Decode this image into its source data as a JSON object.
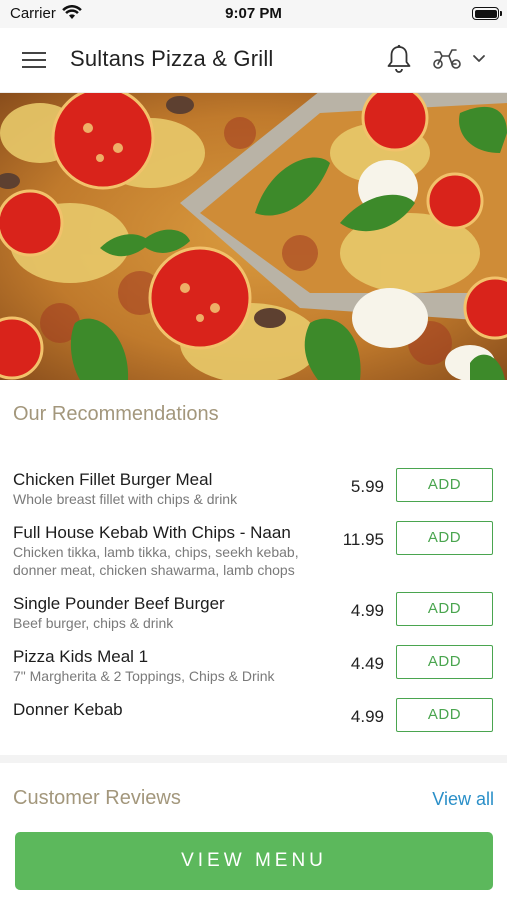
{
  "status_bar": {
    "carrier": "Carrier",
    "time": "9:07 PM"
  },
  "header": {
    "title": "Sultans Pizza & Grill"
  },
  "recommendations": {
    "title": "Our Recommendations",
    "items": [
      {
        "name": "Chicken Fillet Burger Meal",
        "desc": "Whole breast fillet with chips & drink",
        "price": "5.99",
        "add_label": "ADD"
      },
      {
        "name": "Full House Kebab With Chips - Naan",
        "desc": "Chicken tikka, lamb tikka, chips, seekh kebab, donner meat, chicken shawarma, lamb chops",
        "price": "11.95",
        "add_label": "ADD"
      },
      {
        "name": "Single Pounder Beef Burger",
        "desc": "Beef burger, chips & drink",
        "price": "4.99",
        "add_label": "ADD"
      },
      {
        "name": "Pizza Kids Meal 1",
        "desc": "7\" Margherita & 2 Toppings, Chips & Drink",
        "price": "4.49",
        "add_label": "ADD"
      },
      {
        "name": "Donner Kebab",
        "desc": "",
        "price": "4.99",
        "add_label": "ADD"
      }
    ]
  },
  "reviews": {
    "title": "Customer Reviews",
    "view_all": "View all"
  },
  "footer": {
    "view_menu": "VIEW MENU"
  },
  "colors": {
    "accent_green": "#5cb85c",
    "add_green": "#4aa54f",
    "link_blue": "#2a8fc8",
    "section_title": "#a3977c"
  },
  "icons": {
    "menu": "hamburger-menu-icon",
    "bell": "bell-icon",
    "delivery": "scooter-icon",
    "dropdown": "chevron-down-icon"
  }
}
